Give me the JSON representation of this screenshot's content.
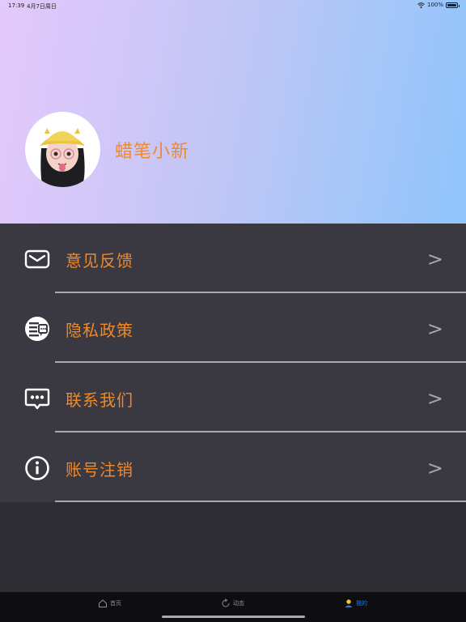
{
  "status_bar": {
    "time": "17:39",
    "date": "4月7日周日",
    "battery": "100%"
  },
  "profile": {
    "username": "蜡笔小新"
  },
  "menu": [
    {
      "label": "意见反馈",
      "icon": "mail-icon",
      "chevron": ">"
    },
    {
      "label": "隐私政策",
      "icon": "document-icon",
      "chevron": ">"
    },
    {
      "label": "联系我们",
      "icon": "chat-icon",
      "chevron": ">"
    },
    {
      "label": "账号注销",
      "icon": "info-icon",
      "chevron": ">"
    }
  ],
  "tabbar": {
    "tabs": [
      {
        "label": "首页",
        "icon": "home-icon",
        "active": false
      },
      {
        "label": "动态",
        "icon": "refresh-icon",
        "active": false
      },
      {
        "label": "我的",
        "icon": "person-icon",
        "active": true
      }
    ]
  },
  "colors": {
    "accent": "#f0892a",
    "menu_bg": "#3a3840",
    "page_bg": "#2e2d33",
    "tab_active": "#0a84ff"
  }
}
